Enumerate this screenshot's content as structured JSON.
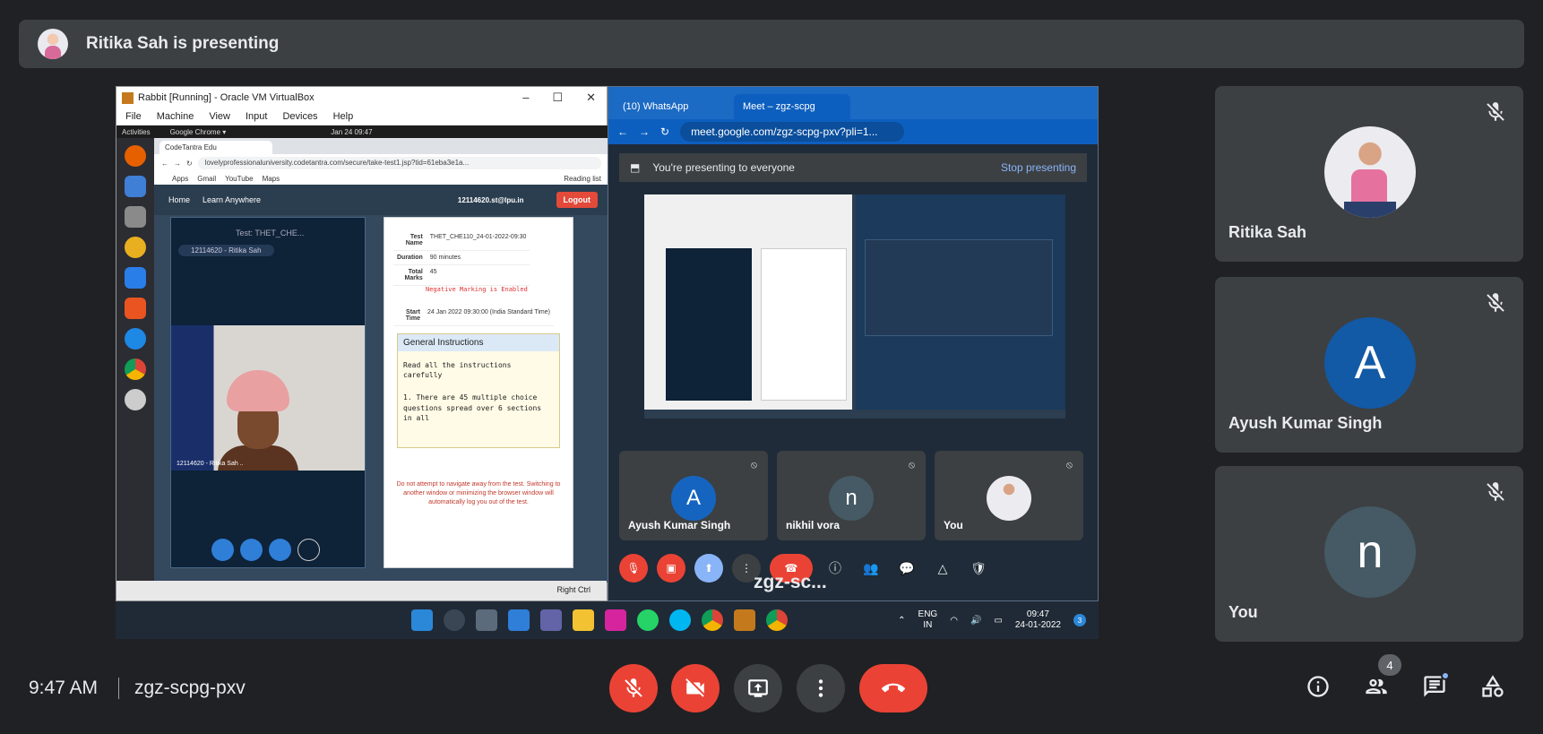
{
  "banner": {
    "text": "Ritika Sah is presenting"
  },
  "shared_screen": {
    "vbox": {
      "title": "Rabbit [Running] - Oracle VM VirtualBox",
      "menu": [
        "File",
        "Machine",
        "View",
        "Input",
        "Devices",
        "Help"
      ],
      "ubuntu_topbar": {
        "activities": "Activities",
        "app": "Google Chrome ▾",
        "clock": "Jan 24  09:47"
      },
      "chrome": {
        "tab": "CodeTantra Edu",
        "url": "lovelyprofessionaluniversity.codetantra.com/secure/take-test1.jsp?tid=61eba3e1a...",
        "bookmarks": [
          "Apps",
          "Gmail",
          "YouTube",
          "Maps"
        ],
        "reading_list": "Reading list"
      },
      "codetantra": {
        "nav_home": "Home",
        "nav_learn": "Learn Anywhere",
        "user": "12114620.st@lpu.in",
        "logout": "Logout",
        "test_label": "Test: THET_CHE...",
        "name_pill": "12114620 - Ritika Sah",
        "cam_caption": "12114620 - Ritika Sah ..",
        "rows": [
          {
            "k": "Test Name",
            "v": "THET_CHE110_24-01-2022-09:30"
          },
          {
            "k": "Duration",
            "v": "90 minutes"
          },
          {
            "k": "Total Marks",
            "v": "45"
          }
        ],
        "negative": "Negative Marking is Enabled",
        "start_k": "Start Time",
        "start_v": "24 Jan 2022 09:30:00 (India Standard Time)",
        "gi_title": "General Instructions",
        "gi_line1": "Read all the instructions carefully",
        "gi_line2": "1. There are 45 multiple choice questions spread over 6 sections in all",
        "warning": "Do not attempt to navigate away from the test. Switching to another window or minimizing the browser window will automatically log you out of the test."
      },
      "status_right": "Right Ctrl"
    },
    "meet_window": {
      "tab1": "(10) WhatsApp",
      "tab2": "Meet – zgz-scpg",
      "url": "meet.google.com/zgz-scpg-pxv?pli=1...",
      "presenting": "You're presenting to everyone",
      "stop": "Stop presenting",
      "tiles": [
        {
          "initial": "A",
          "name": "Ayush Kumar Singh",
          "color": "#1565c0"
        },
        {
          "initial": "n",
          "name": "nikhil vora",
          "color": "#455a64"
        },
        {
          "initial": "",
          "name": "You",
          "color": "#ececf0"
        }
      ],
      "code": "zgz-sc...",
      "people_count": "4"
    },
    "taskbar": {
      "lang1": "ENG",
      "lang2": "IN",
      "time": "09:47",
      "date": "24-01-2022",
      "notif": "3"
    }
  },
  "participants": [
    {
      "name": "Ritika Sah",
      "initial": "",
      "color": "#ececf0"
    },
    {
      "name": "Ayush Kumar Singh",
      "initial": "A",
      "color": "#1259a6"
    },
    {
      "name": "You",
      "initial": "n",
      "color": "#455a64"
    }
  ],
  "footer": {
    "time": "9:47 AM",
    "meeting_code": "zgz-scpg-pxv",
    "people_count": "4"
  },
  "colors": {
    "danger": "#ea4335",
    "surface": "#3c4043",
    "background": "#202124",
    "accent": "#8ab4f8"
  },
  "icons": [
    "mic-off-icon",
    "camera-off-icon",
    "present-icon",
    "more-icon",
    "end-call-icon",
    "info-icon",
    "people-icon",
    "chat-icon",
    "activities-icon"
  ]
}
